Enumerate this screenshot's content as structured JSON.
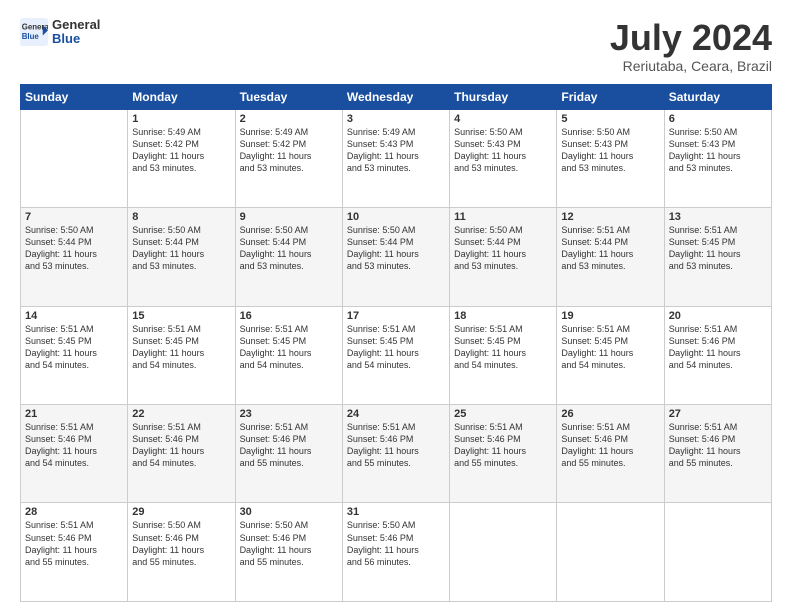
{
  "header": {
    "logo_general": "General",
    "logo_blue": "Blue",
    "month_title": "July 2024",
    "location": "Reriutaba, Ceara, Brazil"
  },
  "weekdays": [
    "Sunday",
    "Monday",
    "Tuesday",
    "Wednesday",
    "Thursday",
    "Friday",
    "Saturday"
  ],
  "weeks": [
    [
      {
        "day": "",
        "info": ""
      },
      {
        "day": "1",
        "info": "Sunrise: 5:49 AM\nSunset: 5:42 PM\nDaylight: 11 hours\nand 53 minutes."
      },
      {
        "day": "2",
        "info": "Sunrise: 5:49 AM\nSunset: 5:42 PM\nDaylight: 11 hours\nand 53 minutes."
      },
      {
        "day": "3",
        "info": "Sunrise: 5:49 AM\nSunset: 5:43 PM\nDaylight: 11 hours\nand 53 minutes."
      },
      {
        "day": "4",
        "info": "Sunrise: 5:50 AM\nSunset: 5:43 PM\nDaylight: 11 hours\nand 53 minutes."
      },
      {
        "day": "5",
        "info": "Sunrise: 5:50 AM\nSunset: 5:43 PM\nDaylight: 11 hours\nand 53 minutes."
      },
      {
        "day": "6",
        "info": "Sunrise: 5:50 AM\nSunset: 5:43 PM\nDaylight: 11 hours\nand 53 minutes."
      }
    ],
    [
      {
        "day": "7",
        "info": "Sunrise: 5:50 AM\nSunset: 5:44 PM\nDaylight: 11 hours\nand 53 minutes."
      },
      {
        "day": "8",
        "info": "Sunrise: 5:50 AM\nSunset: 5:44 PM\nDaylight: 11 hours\nand 53 minutes."
      },
      {
        "day": "9",
        "info": "Sunrise: 5:50 AM\nSunset: 5:44 PM\nDaylight: 11 hours\nand 53 minutes."
      },
      {
        "day": "10",
        "info": "Sunrise: 5:50 AM\nSunset: 5:44 PM\nDaylight: 11 hours\nand 53 minutes."
      },
      {
        "day": "11",
        "info": "Sunrise: 5:50 AM\nSunset: 5:44 PM\nDaylight: 11 hours\nand 53 minutes."
      },
      {
        "day": "12",
        "info": "Sunrise: 5:51 AM\nSunset: 5:44 PM\nDaylight: 11 hours\nand 53 minutes."
      },
      {
        "day": "13",
        "info": "Sunrise: 5:51 AM\nSunset: 5:45 PM\nDaylight: 11 hours\nand 53 minutes."
      }
    ],
    [
      {
        "day": "14",
        "info": "Sunrise: 5:51 AM\nSunset: 5:45 PM\nDaylight: 11 hours\nand 54 minutes."
      },
      {
        "day": "15",
        "info": "Sunrise: 5:51 AM\nSunset: 5:45 PM\nDaylight: 11 hours\nand 54 minutes."
      },
      {
        "day": "16",
        "info": "Sunrise: 5:51 AM\nSunset: 5:45 PM\nDaylight: 11 hours\nand 54 minutes."
      },
      {
        "day": "17",
        "info": "Sunrise: 5:51 AM\nSunset: 5:45 PM\nDaylight: 11 hours\nand 54 minutes."
      },
      {
        "day": "18",
        "info": "Sunrise: 5:51 AM\nSunset: 5:45 PM\nDaylight: 11 hours\nand 54 minutes."
      },
      {
        "day": "19",
        "info": "Sunrise: 5:51 AM\nSunset: 5:45 PM\nDaylight: 11 hours\nand 54 minutes."
      },
      {
        "day": "20",
        "info": "Sunrise: 5:51 AM\nSunset: 5:46 PM\nDaylight: 11 hours\nand 54 minutes."
      }
    ],
    [
      {
        "day": "21",
        "info": "Sunrise: 5:51 AM\nSunset: 5:46 PM\nDaylight: 11 hours\nand 54 minutes."
      },
      {
        "day": "22",
        "info": "Sunrise: 5:51 AM\nSunset: 5:46 PM\nDaylight: 11 hours\nand 54 minutes."
      },
      {
        "day": "23",
        "info": "Sunrise: 5:51 AM\nSunset: 5:46 PM\nDaylight: 11 hours\nand 55 minutes."
      },
      {
        "day": "24",
        "info": "Sunrise: 5:51 AM\nSunset: 5:46 PM\nDaylight: 11 hours\nand 55 minutes."
      },
      {
        "day": "25",
        "info": "Sunrise: 5:51 AM\nSunset: 5:46 PM\nDaylight: 11 hours\nand 55 minutes."
      },
      {
        "day": "26",
        "info": "Sunrise: 5:51 AM\nSunset: 5:46 PM\nDaylight: 11 hours\nand 55 minutes."
      },
      {
        "day": "27",
        "info": "Sunrise: 5:51 AM\nSunset: 5:46 PM\nDaylight: 11 hours\nand 55 minutes."
      }
    ],
    [
      {
        "day": "28",
        "info": "Sunrise: 5:51 AM\nSunset: 5:46 PM\nDaylight: 11 hours\nand 55 minutes."
      },
      {
        "day": "29",
        "info": "Sunrise: 5:50 AM\nSunset: 5:46 PM\nDaylight: 11 hours\nand 55 minutes."
      },
      {
        "day": "30",
        "info": "Sunrise: 5:50 AM\nSunset: 5:46 PM\nDaylight: 11 hours\nand 55 minutes."
      },
      {
        "day": "31",
        "info": "Sunrise: 5:50 AM\nSunset: 5:46 PM\nDaylight: 11 hours\nand 56 minutes."
      },
      {
        "day": "",
        "info": ""
      },
      {
        "day": "",
        "info": ""
      },
      {
        "day": "",
        "info": ""
      }
    ]
  ]
}
